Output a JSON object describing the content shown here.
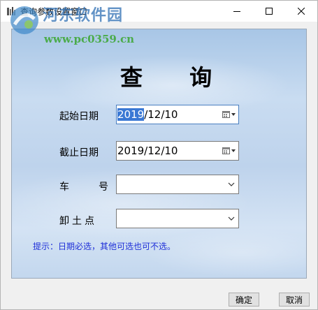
{
  "window": {
    "title": "查询参数设置窗口"
  },
  "watermark": {
    "brand": "河东软件园",
    "url": "www.pc0359.cn"
  },
  "form": {
    "heading": "查 询",
    "start_label": "起始日期",
    "start_value_selected": "2019",
    "start_value_rest": "/12/10",
    "end_label": "截止日期",
    "end_value": "2019/12/10",
    "car_label_a": "车",
    "car_label_b": "号",
    "car_value": "",
    "unload_label": "卸土点",
    "unload_value": "",
    "hint": "提示：日期必选，其他可选也可不选。"
  },
  "buttons": {
    "ok": "确定",
    "cancel": "取消"
  },
  "colors": {
    "hint": "#1f2fd8",
    "selection": "#3a78d4",
    "watermark_title": "#2f6fb3",
    "watermark_url": "#3aa62f"
  }
}
